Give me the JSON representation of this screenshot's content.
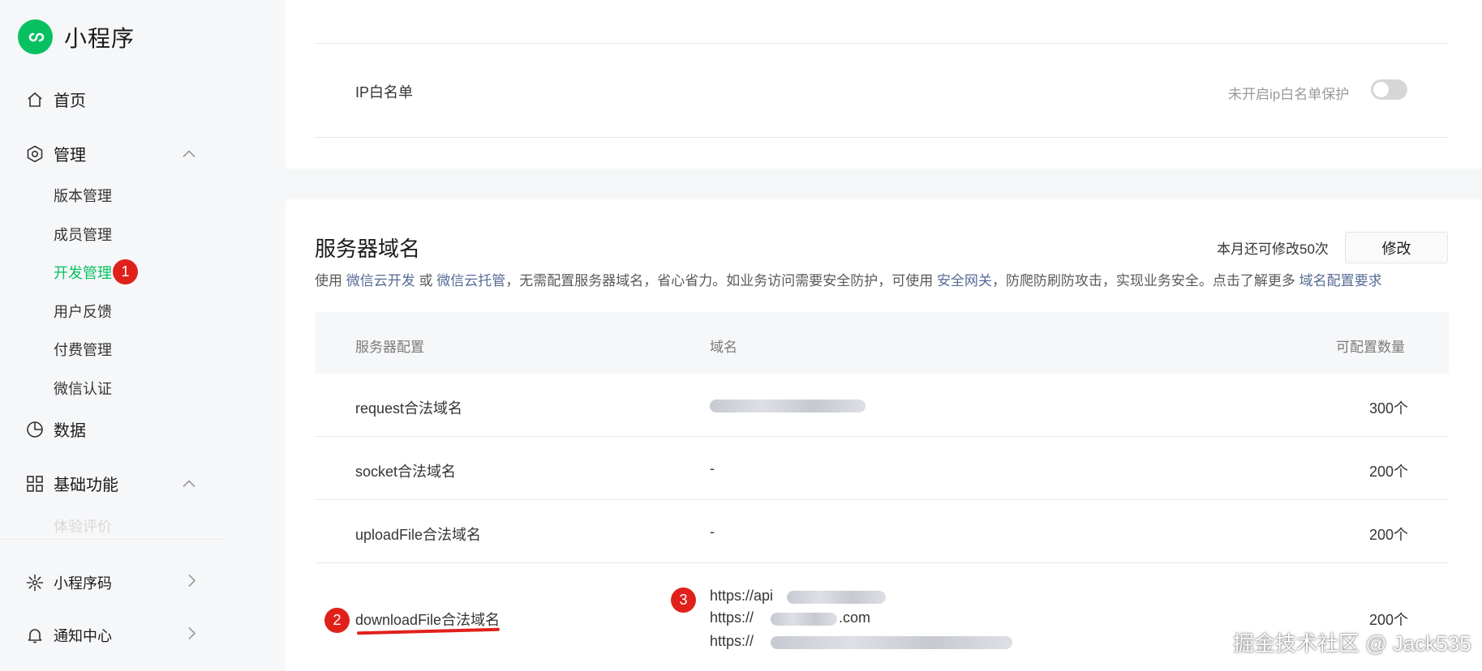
{
  "app": {
    "title": "小程序"
  },
  "sidebar": {
    "home": "首页",
    "manage": "管理",
    "manage_items": [
      "版本管理",
      "成员管理",
      "开发管理",
      "用户反馈",
      "付费管理",
      "微信认证"
    ],
    "data": "数据",
    "basic": "基础功能",
    "basic_items": [
      "体验评价"
    ],
    "qrcode": "小程序码",
    "notify": "通知中心"
  },
  "annotations": {
    "b1": "1",
    "b2": "2",
    "b3": "3"
  },
  "top_section": {
    "ip_label": "IP白名单",
    "ip_status": "未开启ip白名单保护",
    "ip_enabled": false
  },
  "server": {
    "title": "服务器域名",
    "quota": "本月还可修改50次",
    "edit": "修改",
    "desc_1": "使用",
    "link_1": "微信云开发",
    "desc_2": "或",
    "link_2": "微信云托管",
    "desc_3": "，无需配置服务器域名，省心省力。如业务访问需要安全防护，可使用",
    "link_3": "安全网关",
    "desc_4": "，防爬防刷防攻击，实现业务安全。点击了解更多",
    "link_4": "域名配置要求",
    "headers": {
      "config": "服务器配置",
      "domain": "域名",
      "count": "可配置数量"
    },
    "rows": [
      {
        "name": "request合法域名",
        "domain": "",
        "count": "300个"
      },
      {
        "name": "socket合法域名",
        "domain": "-",
        "count": "200个"
      },
      {
        "name": "uploadFile合法域名",
        "domain": "-",
        "count": "200个"
      },
      {
        "name": "downloadFile合法域名",
        "domain_lines": [
          "https://api",
          "https://",
          "https://"
        ],
        "count": "200个"
      }
    ],
    "download_domain_mid": ".com"
  },
  "watermark": "掘金技术社区 @ Jack535"
}
